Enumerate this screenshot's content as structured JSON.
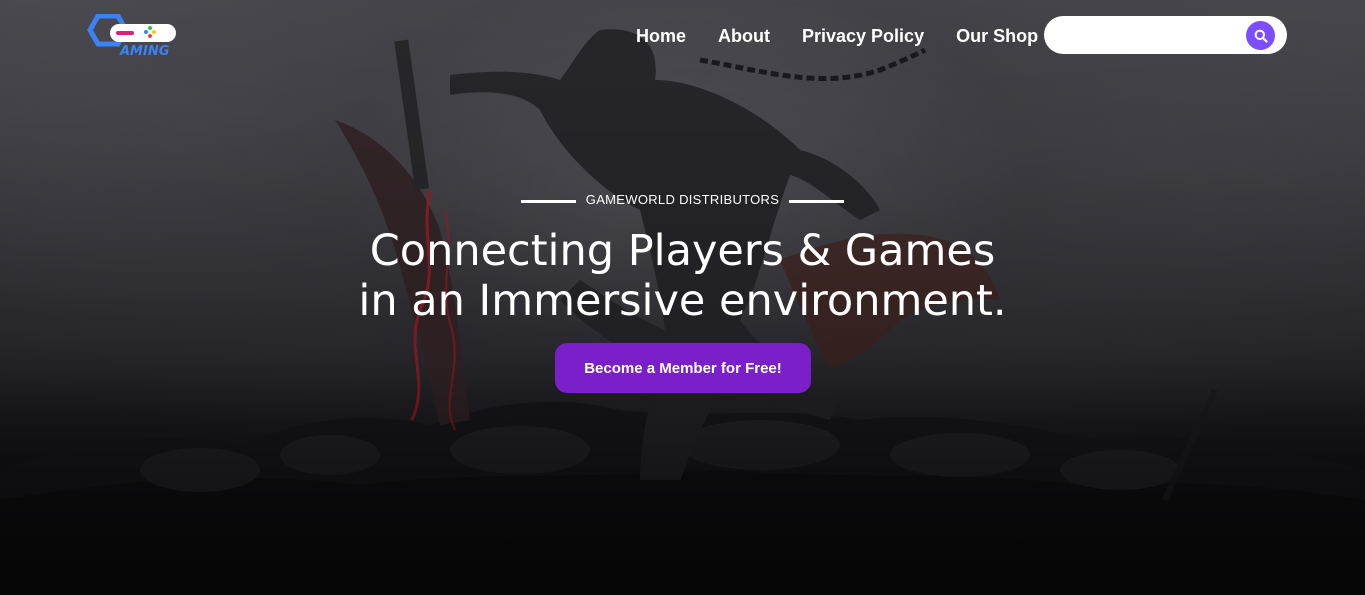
{
  "brand": {
    "logo_text": "AMING",
    "logo_icon": "gamepad-logo-icon"
  },
  "nav": {
    "items": [
      {
        "label": "Home"
      },
      {
        "label": "About"
      },
      {
        "label": "Privacy Policy"
      },
      {
        "label": "Our Shop"
      }
    ]
  },
  "search": {
    "value": "",
    "icon": "search-icon"
  },
  "hero": {
    "eyebrow": "GAMEWORLD DISTRIBUTORS",
    "headline_line1": "Connecting Players & Games",
    "headline_line2": "in an Immersive environment.",
    "cta_label": "Become a Member for Free!"
  },
  "colors": {
    "accent": "#7a1fc9",
    "search_button": "#7c4dff",
    "logo_blue": "#3b82f6",
    "logo_pink": "#e11d74"
  }
}
